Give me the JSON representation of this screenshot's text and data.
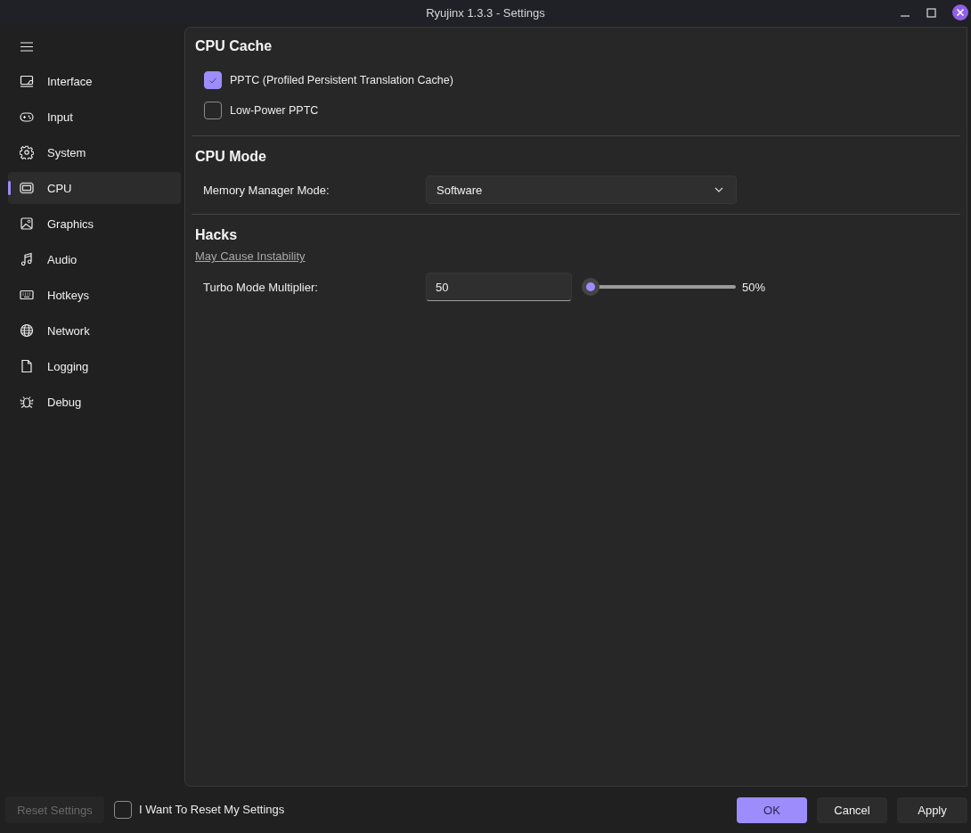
{
  "window": {
    "title": "Ryujinx 1.3.3 - Settings"
  },
  "sidebar": {
    "items": [
      {
        "label": "Interface",
        "selected": false
      },
      {
        "label": "Input",
        "selected": false
      },
      {
        "label": "System",
        "selected": false
      },
      {
        "label": "CPU",
        "selected": true
      },
      {
        "label": "Graphics",
        "selected": false
      },
      {
        "label": "Audio",
        "selected": false
      },
      {
        "label": "Hotkeys",
        "selected": false
      },
      {
        "label": "Network",
        "selected": false
      },
      {
        "label": "Logging",
        "selected": false
      },
      {
        "label": "Debug",
        "selected": false
      }
    ]
  },
  "content": {
    "sections": [
      {
        "title": "CPU Cache",
        "rows": [
          {
            "kind": "checkbox",
            "label": "PPTC (Profiled Persistent Translation Cache)",
            "checked": true
          },
          {
            "kind": "checkbox",
            "label": "Low-Power PPTC",
            "checked": false
          }
        ]
      },
      {
        "title": "CPU Mode",
        "rows": [
          {
            "kind": "dropdown",
            "label": "Memory Manager Mode:",
            "value": "Software"
          }
        ]
      },
      {
        "title": "Hacks",
        "subtitle": "May Cause Instability",
        "rows": [
          {
            "kind": "slider",
            "label": "Turbo Mode Multiplier:",
            "value": "50",
            "level": 0,
            "reading": "50%"
          }
        ]
      }
    ]
  },
  "footer": {
    "reset_button": {
      "label": "Reset Settings",
      "disabled": true
    },
    "reset_confirm": {
      "label": "I Want To Reset My Settings",
      "checked": false
    },
    "buttons": [
      {
        "label": "OK",
        "kind": "primary"
      },
      {
        "label": "Cancel",
        "kind": "secondary"
      },
      {
        "label": "Apply",
        "kind": "secondary"
      }
    ]
  }
}
